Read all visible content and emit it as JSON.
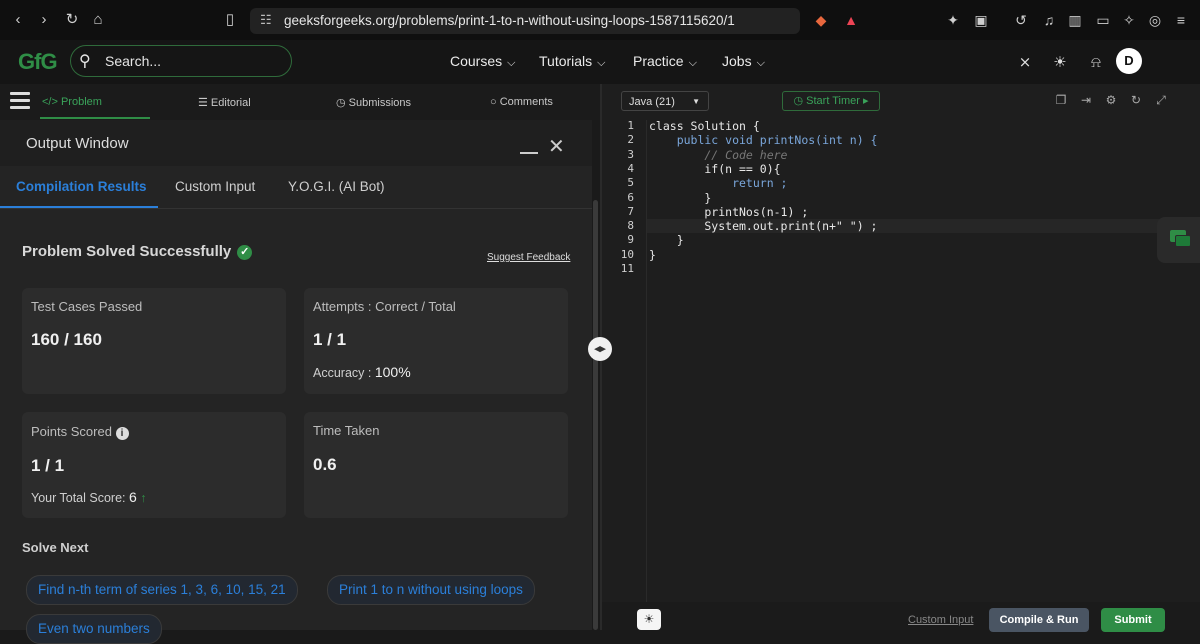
{
  "browser": {
    "url": "geeksforgeeks.org/problems/print-1-to-n-without-using-loops-1587115620/1"
  },
  "header": {
    "logo": "GfG",
    "search_placeholder": "Search...",
    "nav": [
      "Courses",
      "Tutorials",
      "Practice",
      "Jobs"
    ],
    "avatar_initial": "D"
  },
  "left_tabs": {
    "problem": "Problem",
    "editorial": "Editorial",
    "submissions": "Submissions",
    "comments": "Comments"
  },
  "output_window": {
    "title": "Output Window",
    "tabs": [
      "Compilation Results",
      "Custom Input",
      "Y.O.G.I. (AI Bot)"
    ],
    "status": "Problem Solved Successfully",
    "suggest_feedback": "Suggest Feedback",
    "cards": {
      "test_cases_label": "Test Cases Passed",
      "test_cases_value": "160 / 160",
      "attempts_label": "Attempts : Correct / Total",
      "attempts_value": "1 / 1",
      "accuracy_label": "Accuracy :",
      "accuracy_value": "100%",
      "points_label": "Points Scored",
      "points_value": "1 / 1",
      "total_score_label": "Your Total Score:",
      "total_score_value": "6",
      "time_label": "Time Taken",
      "time_value": "0.6"
    },
    "solve_next_title": "Solve Next",
    "solve_next": [
      "Find n-th term of series 1, 3, 6, 10, 15, 21",
      "Print 1 to n without using loops",
      "Even two numbers"
    ]
  },
  "editor": {
    "language": "Java (21)",
    "timer": "Start Timer",
    "line_numbers": [
      "1",
      "2",
      "3",
      "4",
      "5",
      "6",
      "7",
      "8",
      "9",
      "10",
      "11"
    ],
    "code": [
      "class Solution {",
      "    public void printNos(int n) {",
      "        // Code here",
      "        if(n == 0){",
      "            return ;",
      "        }",
      "        printNos(n-1) ;",
      "        System.out.print(n+\" \") ;",
      "    }",
      "}",
      ""
    ]
  },
  "bottom": {
    "custom_input": "Custom Input",
    "compile_run": "Compile & Run",
    "submit": "Submit"
  },
  "colors": {
    "brand_green": "#2f8d46",
    "accent_blue": "#2b7fd9"
  }
}
